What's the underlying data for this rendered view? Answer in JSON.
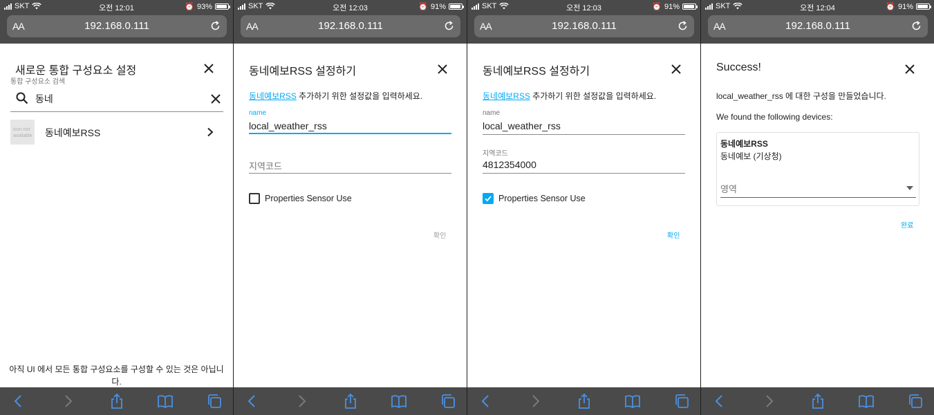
{
  "screens": [
    {
      "status": {
        "carrier": "SKT",
        "time": "오전 12:01",
        "battery_pct": "93%",
        "battery_level": 0.93
      },
      "url": "192.168.0.111",
      "aa": "AA",
      "dialog": {
        "title": "새로운 통합 구성요소 설정",
        "search_label": "통합 구성요소 검색",
        "search_value": "동네",
        "result_icon_text": "icon not available",
        "result_label": "동네예보RSS",
        "footer_note": "아직 UI 에서 모든 통합 구성요소를 구성할 수 있는 것은 아닙니다."
      }
    },
    {
      "status": {
        "carrier": "SKT",
        "time": "오전 12:03",
        "battery_pct": "91%",
        "battery_level": 0.91
      },
      "url": "192.168.0.111",
      "aa": "AA",
      "dialog": {
        "title": "동네예보RSS 설정하기",
        "desc_link": "동네예보RSS",
        "desc_text": " 추가하기 위한 설정값을 입력하세요.",
        "name_label": "name",
        "name_value": "local_weather_rss",
        "region_placeholder": "지역코드",
        "checkbox_label": "Properties Sensor Use",
        "checkbox_checked": false,
        "confirm": "확인"
      }
    },
    {
      "status": {
        "carrier": "SKT",
        "time": "오전 12:03",
        "battery_pct": "91%",
        "battery_level": 0.91
      },
      "url": "192.168.0.111",
      "aa": "AA",
      "dialog": {
        "title": "동네예보RSS 설정하기",
        "desc_link": "동네예보RSS",
        "desc_text": " 추가하기 위한 설정값을 입력하세요.",
        "name_label": "name",
        "name_value": "local_weather_rss",
        "region_label": "지역코드",
        "region_value": "4812354000",
        "checkbox_label": "Properties Sensor Use",
        "checkbox_checked": true,
        "confirm": "확인"
      }
    },
    {
      "status": {
        "carrier": "SKT",
        "time": "오전 12:04",
        "battery_pct": "91%",
        "battery_level": 0.91
      },
      "url": "192.168.0.111",
      "aa": "AA",
      "dialog": {
        "title": "Success!",
        "created_msg": "local_weather_rss 에 대한 구성을 만들었습니다.",
        "found_msg": "We found the following devices:",
        "device_name": "동네예보RSS",
        "device_model": "동네예보 (기상청)",
        "area_placeholder": "영역",
        "finish": "완료"
      }
    }
  ],
  "colors": {
    "accent": "#03a9f4",
    "chrome": "#4a4a4a",
    "urlbar": "#6b6b6b",
    "toolbar_icon": "#4a90e2"
  }
}
